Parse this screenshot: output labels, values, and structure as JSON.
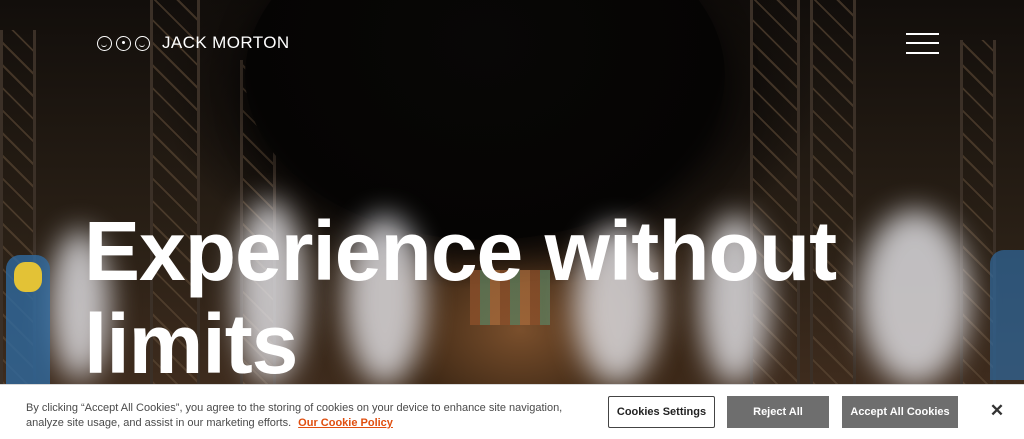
{
  "header": {
    "logo_text": "JACK MORTON",
    "logo_icon": "three-faces-logo-icon",
    "menu_icon": "hamburger-menu-icon"
  },
  "hero": {
    "headline": "Experience without limits"
  },
  "cookie_banner": {
    "message": "By clicking “Accept All Cookies”, you agree to the storing of cookies on your device to enhance site navigation, analyze site usage, and assist in our marketing efforts.",
    "policy_link": "Our Cookie Policy",
    "settings_label": "Cookies Settings",
    "reject_label": "Reject All",
    "accept_label": "Accept All Cookies",
    "close_label": "✕",
    "close_icon": "close-icon"
  },
  "colors": {
    "link": "#e04e0e",
    "button_gray": "#6e6e6e",
    "text_white": "#ffffff"
  }
}
